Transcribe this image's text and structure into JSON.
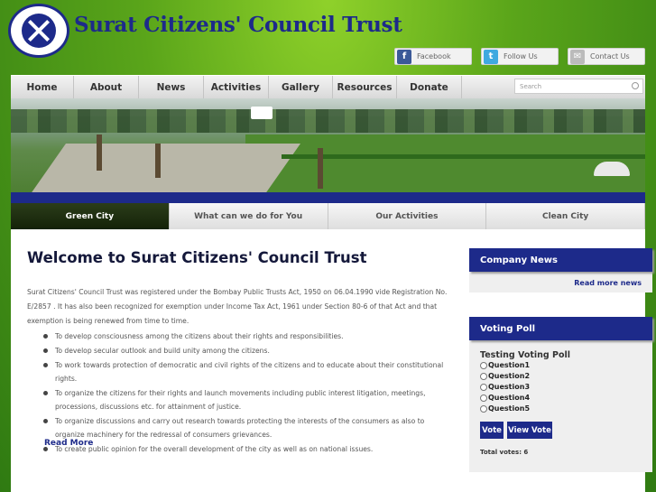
{
  "header": {
    "title": "Surat Citizens' Council Trust",
    "logo_icon": "trust-logo-icon"
  },
  "social": [
    {
      "label": "Facebook",
      "icon": "facebook-icon",
      "glyph": "f"
    },
    {
      "label": "Follow Us",
      "icon": "twitter-icon",
      "glyph": "t"
    },
    {
      "label": "Contact Us",
      "icon": "mail-icon",
      "glyph": "✉"
    }
  ],
  "nav": {
    "items": [
      "Home",
      "About",
      "News",
      "Activities",
      "Gallery",
      "Resources",
      "Donate"
    ],
    "search_placeholder": "Search"
  },
  "subtabs": {
    "items": [
      "Green City",
      "What can we do for You",
      "Our Activities",
      "Clean City"
    ],
    "active": "Green City"
  },
  "main": {
    "title": "Welcome to Surat Citizens' Council Trust",
    "intro": "Surat Citizens' Council Trust was registered under the Bombay Public Trusts Act, 1950 on 06.04.1990 vide Registration No. E/2857 . It has also been recognized for exemption under Income Tax Act, 1961 under Section 80-6 of that Act and that exemption is being renewed from time to time.",
    "objectives": [
      "To develop consciousness among the citizens about their rights and responsibilities.",
      "To develop secular outlook and build unity among the citizens.",
      "To work towards protection of democratic and civil rights of the citizens and to educate about their constitutional rights.",
      "To organize the citizens for their rights and launch movements including public interest litigation, meetings, processions, discussions etc. for attainment of justice.",
      "To organize discussions and carry out research towards protecting the interests of the consumers as also to organize machinery for the redressal of consumers grievances.",
      "To create public opinion for the overall development of the city as well as on national issues."
    ],
    "read_more": "Read More"
  },
  "sidebar": {
    "company_news": {
      "title": "Company News",
      "read_more": "Read more news"
    },
    "poll": {
      "title": "Voting Poll",
      "question": "Testing Voting Poll",
      "options": [
        "Question1",
        "Question2",
        "Question3",
        "Question4",
        "Question5"
      ],
      "vote_label": "Vote",
      "view_label": "View Vote",
      "total": "Total votes: 6"
    }
  },
  "colors": {
    "brand_blue": "#1d2a8a",
    "active_tab": "#1d2a0c",
    "background_green": "#5aa51a"
  }
}
